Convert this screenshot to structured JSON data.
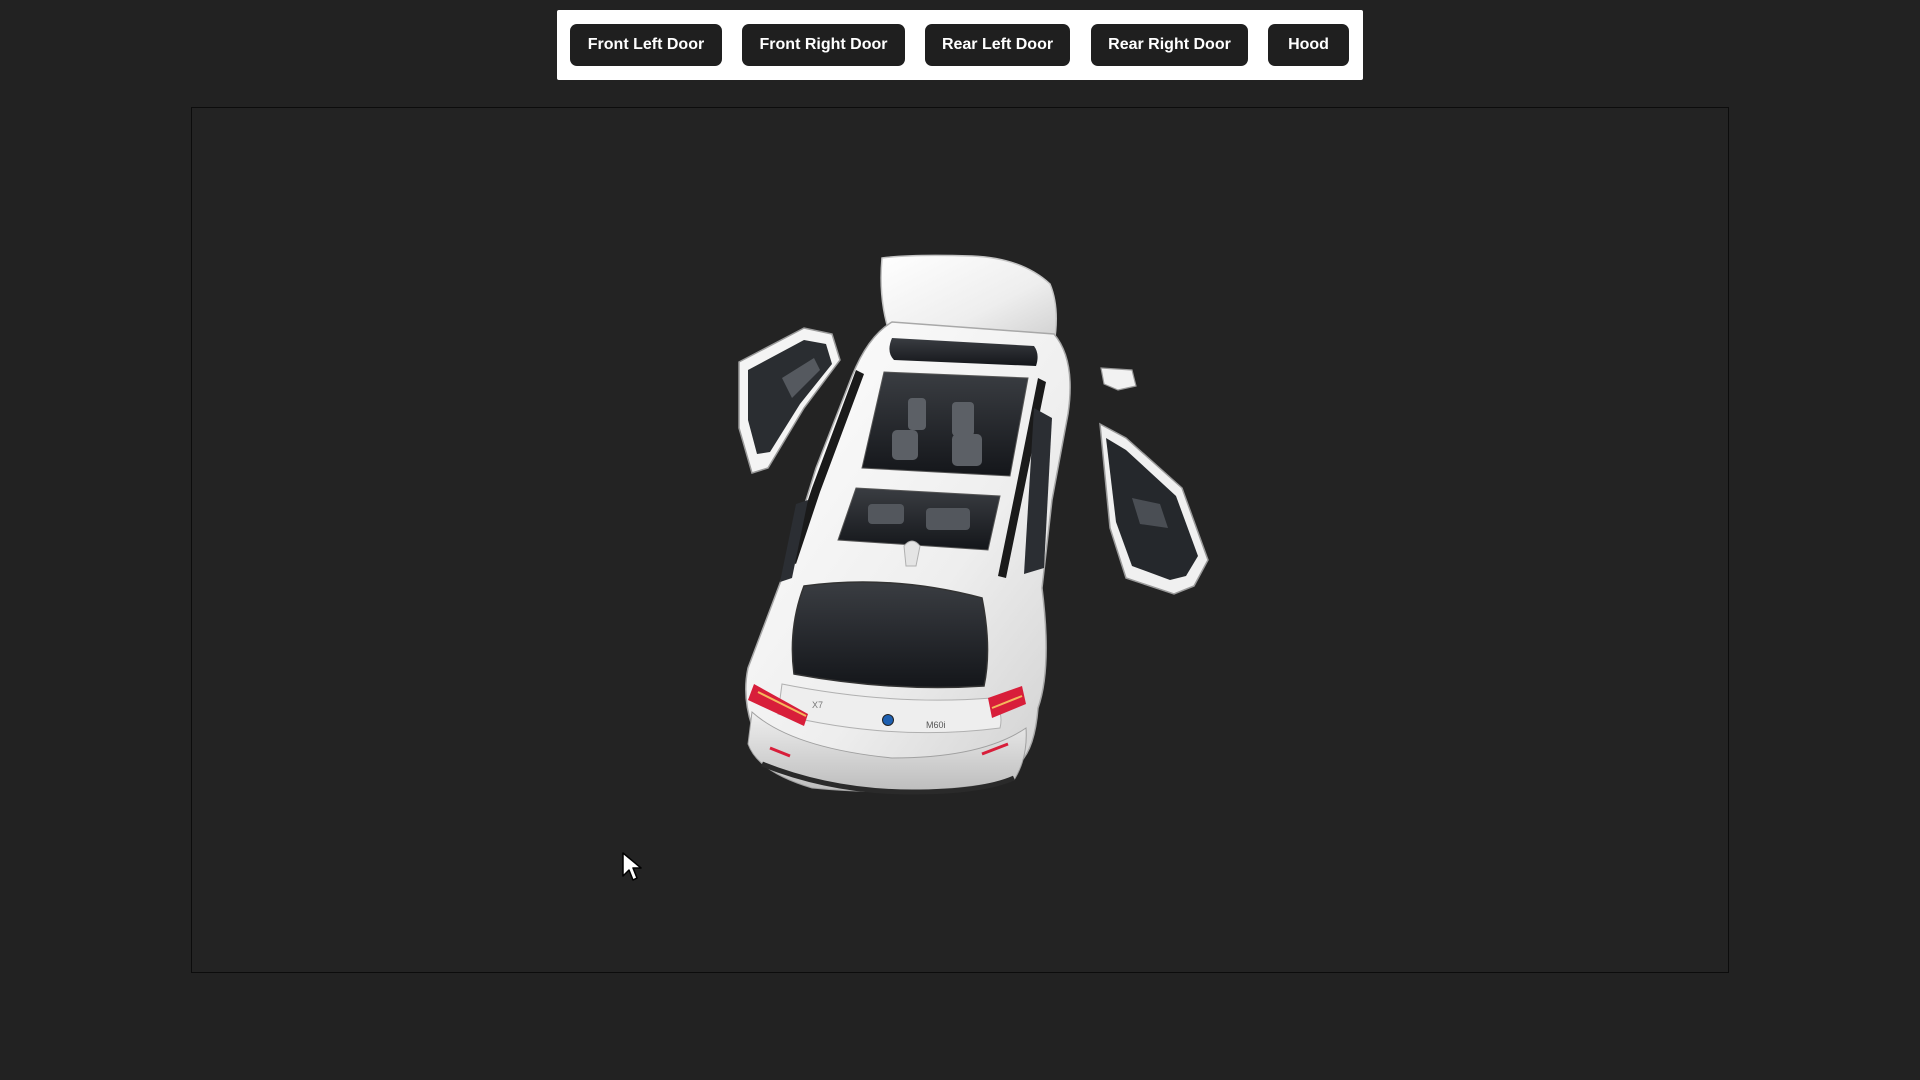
{
  "toolbar": {
    "buttons": [
      {
        "id": "front_left_door",
        "label": "Front Left Door"
      },
      {
        "id": "front_right_door",
        "label": "Front Right Door"
      },
      {
        "id": "rear_left_door",
        "label": "Rear Left Door"
      },
      {
        "id": "rear_right_door",
        "label": "Rear Right Door"
      },
      {
        "id": "hood",
        "label": "Hood"
      }
    ]
  },
  "viewer": {
    "model": "white SUV, top-rear view, front left door and front right door open",
    "rear_badge": "M60i",
    "model_badge": "X7"
  },
  "colors": {
    "background": "#222222",
    "toolbar_background": "#ffffff",
    "button_background": "#1f1f1f",
    "button_text": "#ffffff",
    "car_body": "#f2f2f2",
    "glass": "#1c1f24",
    "taillight": "#d81e3a"
  },
  "icons": {
    "cursor": "mouse-pointer-arrow-icon"
  }
}
